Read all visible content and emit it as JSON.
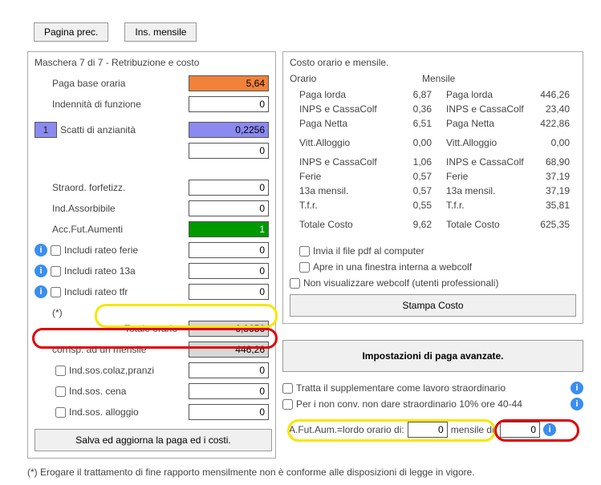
{
  "topbar": {
    "prev": "Pagina prec.",
    "ins": "Ins. mensile"
  },
  "left": {
    "title": "Maschera 7 di 7 - Retribuzione e costo",
    "paga_base_lbl": "Paga base oraria",
    "paga_base_val": "5,64",
    "indennita_lbl": "Indennità di funzione",
    "indennita_val": "0",
    "scatti_n": "1",
    "scatti_lbl": "Scatti di anzianità",
    "scatti_val": "0,2256",
    "blank1_val": "0",
    "straord_lbl": "Straord. forfetizz.",
    "straord_val": "0",
    "assorb_lbl": "Ind.Assorbibile",
    "assorb_val": "0",
    "accfut_lbl": "Acc.Fut.Aumenti",
    "accfut_val": "1",
    "rateo_ferie_lbl": "Includi rateo ferie",
    "rateo_ferie_val": "0",
    "rateo_13a_lbl": "Includi rateo 13a",
    "rateo_13a_val": "0",
    "rateo_tfr_lbl": "Includi rateo tfr",
    "rateo_tfr_val": "0",
    "star": "(*)",
    "totale_lbl": "Totale orario",
    "totale_val": "6,8656",
    "corrisp_lbl": "corrisp. ad un mensile",
    "corrisp_val": "446,26",
    "colaz_lbl": "Ind.sos.colaz,pranzi",
    "colaz_val": "0",
    "cena_lbl": "Ind.sos. cena",
    "cena_val": "0",
    "allogg_lbl": "Ind.sos. alloggio",
    "allogg_val": "0",
    "save_btn": "Salva ed aggiorna la paga ed i costi."
  },
  "right": {
    "title": "Costo orario e mensile.",
    "h_orario": "Orario",
    "h_mensile": "Mensile",
    "rows": [
      {
        "l": "Paga lorda",
        "v1": "6,87",
        "r": "Paga lorda",
        "v2": "446,26"
      },
      {
        "l": "INPS e CassaColf",
        "v1": "0,36",
        "r": "INPS e CassaColf",
        "v2": "23,40"
      },
      {
        "l": "Paga Netta",
        "v1": "6,51",
        "r": "Paga Netta",
        "v2": "422,86"
      }
    ],
    "vitt": {
      "l": "Vitt.Alloggio",
      "v1": "0,00",
      "r": "Vitt.Alloggio",
      "v2": "0,00"
    },
    "rows2": [
      {
        "l": "INPS e CassaColf",
        "v1": "1,06",
        "r": "INPS e CassaColf",
        "v2": "68,90"
      },
      {
        "l": "Ferie",
        "v1": "0,57",
        "r": "Ferie",
        "v2": "37,19"
      },
      {
        "l": "13a mensil.",
        "v1": "0,57",
        "r": "13a mensil.",
        "v2": "37,19"
      },
      {
        "l": "T.f.r.",
        "v1": "0,55",
        "r": "T.f.r.",
        "v2": "35,81"
      }
    ],
    "tot": {
      "l": "Totale Costo",
      "v1": "9,62",
      "r": "Totale Costo",
      "v2": "625,35"
    },
    "pdf_lbl": "Invia il file pdf al computer",
    "window_lbl": "Apre in una finestra interna a webcolf",
    "nonvis_lbl": "Non visualizzare webcolf (utenti professionali)",
    "stampa_btn": "Stampa Costo",
    "impost_btn": "Impostazioni di paga avanzate.",
    "suppl_lbl": "Tratta il supplementare come lavoro straordinario",
    "nonconv_lbl": "Per i non conv. non dare straordinario 10% ore 40-44",
    "afut_lbl": "A.Fut.Aum.=lordo orario di:",
    "afut_val": "0",
    "mensile_lbl": "mensile di:",
    "mensile_val": "0"
  },
  "footnote": "(*) Erogare il trattamento di fine rapporto mensilmente non è conforme alle disposizioni di legge in vigore."
}
